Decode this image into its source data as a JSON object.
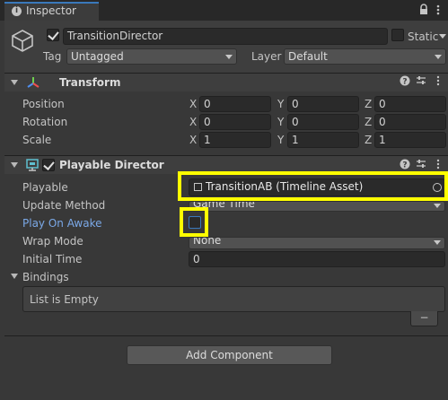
{
  "tab": {
    "icon": "info-icon",
    "title": "Inspector"
  },
  "gameobject": {
    "name": "TransitionDirector",
    "static_label": "Static",
    "tag_label": "Tag",
    "tag_value": "Untagged",
    "layer_label": "Layer",
    "layer_value": "Default"
  },
  "transform": {
    "title": "Transform",
    "rows": [
      {
        "label": "Position",
        "x": "0",
        "y": "0",
        "z": "0"
      },
      {
        "label": "Rotation",
        "x": "0",
        "y": "0",
        "z": "0"
      },
      {
        "label": "Scale",
        "x": "1",
        "y": "1",
        "z": "1"
      }
    ],
    "axis": {
      "x": "X",
      "y": "Y",
      "z": "Z"
    }
  },
  "director": {
    "title": "Playable Director",
    "playable_label": "Playable",
    "playable_value": "TransitionAB (Timeline Asset)",
    "update_method_label": "Update Method",
    "update_method_value": "Game Time",
    "play_on_awake_label": "Play On Awake",
    "wrap_mode_label": "Wrap Mode",
    "wrap_mode_value": "None",
    "initial_time_label": "Initial Time",
    "initial_time_value": "0",
    "bindings_label": "Bindings",
    "list_empty": "List is Empty",
    "minus": "−"
  },
  "add_component": "Add Component",
  "colors": {
    "highlight": "#ffff00",
    "link_label": "#7ba9e8"
  }
}
